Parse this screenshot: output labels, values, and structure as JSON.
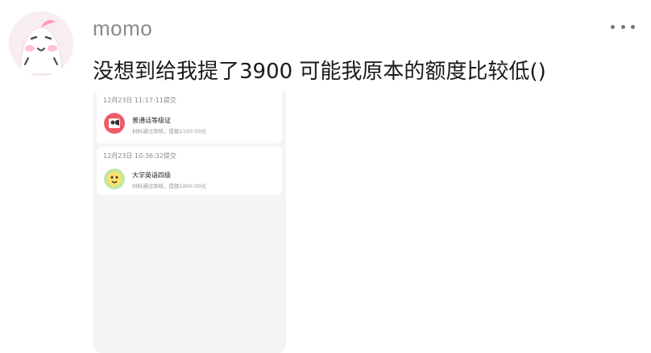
{
  "post": {
    "username": "momo",
    "text": "没想到给我提了3900 可能我原本的额度比较低()",
    "more_icon": "more-horizontal-icon"
  },
  "screenshot": {
    "items": [
      {
        "timestamp": "12月23日 11:17:11提交",
        "title": "普通话等级证",
        "subtitle": "材料通过审核，提额2100.00元",
        "icon": "mandarin-cert-icon"
      },
      {
        "timestamp": "12月23日 10:36:32提交",
        "title": "大学英语四级",
        "subtitle": "材料通过审核，提额1800.00元",
        "icon": "cet4-icon"
      }
    ]
  }
}
